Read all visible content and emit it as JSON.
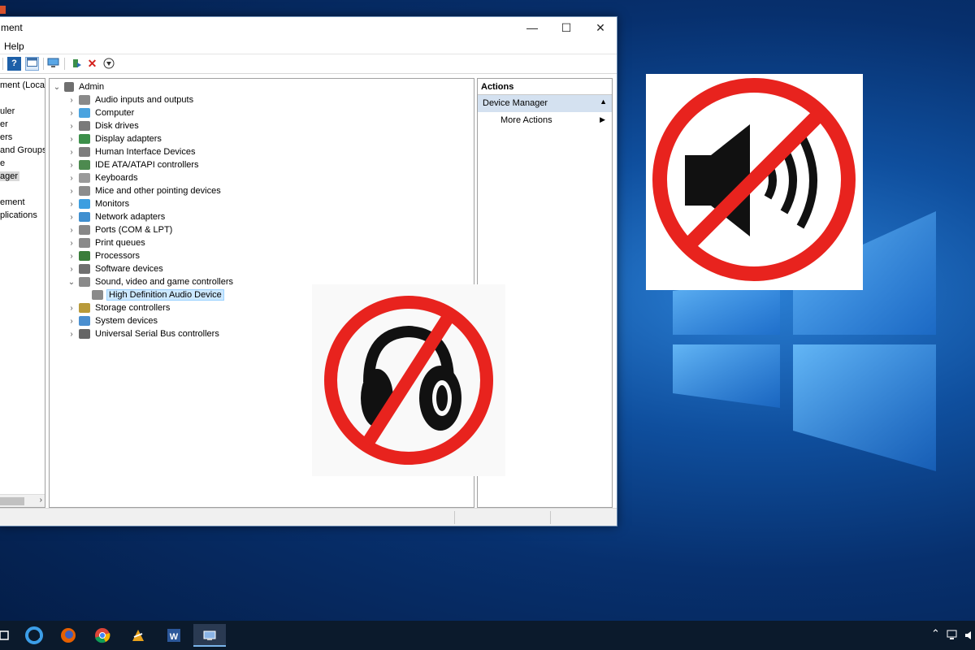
{
  "window": {
    "title": "ment",
    "menu_help": "Help",
    "controls": {
      "minimize": "—",
      "maximize": "☐",
      "close": "✕"
    }
  },
  "left_pane": {
    "items": [
      "ment (Local",
      "uler",
      "er",
      "ers",
      "and Groups",
      "e",
      "ager",
      "ement",
      "plications"
    ],
    "selected_index": 6
  },
  "tree": {
    "root": "Admin",
    "nodes": [
      {
        "label": "Audio inputs and outputs",
        "icon": "speaker-icon",
        "color": "#8a8a8a"
      },
      {
        "label": "Computer",
        "icon": "computer-icon",
        "color": "#4aa3df"
      },
      {
        "label": "Disk drives",
        "icon": "disk-drive-icon",
        "color": "#7a7a7a"
      },
      {
        "label": "Display adapters",
        "icon": "display-adapter-icon",
        "color": "#3c8f4a"
      },
      {
        "label": "Human Interface Devices",
        "icon": "hid-icon",
        "color": "#7d7d7d"
      },
      {
        "label": "IDE ATA/ATAPI controllers",
        "icon": "ide-controller-icon",
        "color": "#4d8a4f"
      },
      {
        "label": "Keyboards",
        "icon": "keyboard-icon",
        "color": "#9a9a9a"
      },
      {
        "label": "Mice and other pointing devices",
        "icon": "mouse-icon",
        "color": "#8c8c8c"
      },
      {
        "label": "Monitors",
        "icon": "monitor-icon",
        "color": "#3d9ee0"
      },
      {
        "label": "Network adapters",
        "icon": "network-adapter-icon",
        "color": "#3f8fd0"
      },
      {
        "label": "Ports (COM & LPT)",
        "icon": "port-icon",
        "color": "#888888"
      },
      {
        "label": "Print queues",
        "icon": "printer-icon",
        "color": "#8a8a8a"
      },
      {
        "label": "Processors",
        "icon": "processor-icon",
        "color": "#3a7d3a"
      },
      {
        "label": "Software devices",
        "icon": "software-device-icon",
        "color": "#6f6f6f"
      },
      {
        "label": "Sound, video and game controllers",
        "icon": "sound-controller-icon",
        "color": "#8a8a8a",
        "expanded": true
      },
      {
        "label": "High Definition Audio Device",
        "icon": "audio-device-icon",
        "color": "#8a8a8a",
        "child": true,
        "selected": true
      },
      {
        "label": "Storage controllers",
        "icon": "storage-controller-icon",
        "color": "#b89a3a"
      },
      {
        "label": "System devices",
        "icon": "system-device-icon",
        "color": "#4a8fd0"
      },
      {
        "label": "Universal Serial Bus controllers",
        "icon": "usb-icon",
        "color": "#666666"
      }
    ]
  },
  "actions": {
    "header": "Actions",
    "section": "Device Manager",
    "item": "More Actions"
  },
  "colors": {
    "sign_red": "#e8231e",
    "selection": "#cce8ff"
  }
}
